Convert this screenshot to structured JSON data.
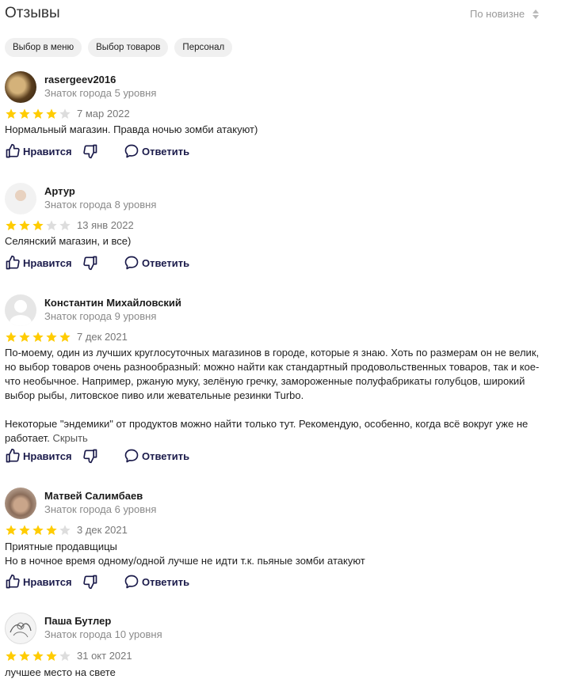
{
  "header": {
    "title": "Отзывы",
    "sort_label": "По новизне"
  },
  "chips": [
    "Выбор в меню",
    "Выбор товаров",
    "Персонал"
  ],
  "actions": {
    "like": "Нравится",
    "reply": "Ответить"
  },
  "colors": {
    "star_filled": "#FFCC00",
    "star_empty": "#DDDDDD",
    "action_icon": "#1a1a4a"
  },
  "reviews": [
    {
      "name": "rasergeev2016",
      "level": "Знаток города 5 уровня",
      "rating": 4,
      "date": "7 мар 2022",
      "paragraphs": [
        "Нормальный магазин. Правда ночью зомби атакуют)"
      ]
    },
    {
      "name": "Артур",
      "level": "Знаток города 8 уровня",
      "rating": 3,
      "date": "13 янв 2022",
      "paragraphs": [
        "Селянский магазин, и все)"
      ]
    },
    {
      "name": "Константин Михайловский",
      "level": "Знаток города 9 уровня",
      "rating": 5,
      "date": "7 дек 2021",
      "paragraphs": [
        "По-моему, один из лучших круглосуточных магазинов в городе, которые я знаю. Хоть по размерам он не велик, но выбор товаров очень разнообразный: можно найти как стандартный продовольственных товаров, так и кое-что необычное. Например, ржаную муку, зелёную гречку, замороженные полуфабрикаты голубцов, широкий выбор рыбы, литовское пиво или жевательные резинки Turbo.",
        "Некоторые \"эндемики\" от продуктов можно найти только тут. Рекомендую, особенно, когда всё вокруг уже не работает."
      ],
      "collapse_label": "Скрыть"
    },
    {
      "name": "Матвей Салимбаев",
      "level": "Знаток города 6 уровня",
      "rating": 4,
      "date": "3 дек 2021",
      "paragraphs": [
        "Приятные продавщицы",
        "Но в ночное время одному/одной лучше не идти т.к. пьяные зомби атакуют"
      ]
    },
    {
      "name": "Паша Бутлер",
      "level": "Знаток города 10 уровня",
      "rating": 4,
      "date": "31 окт 2021",
      "paragraphs": [
        "лучшее место на свете"
      ]
    }
  ]
}
